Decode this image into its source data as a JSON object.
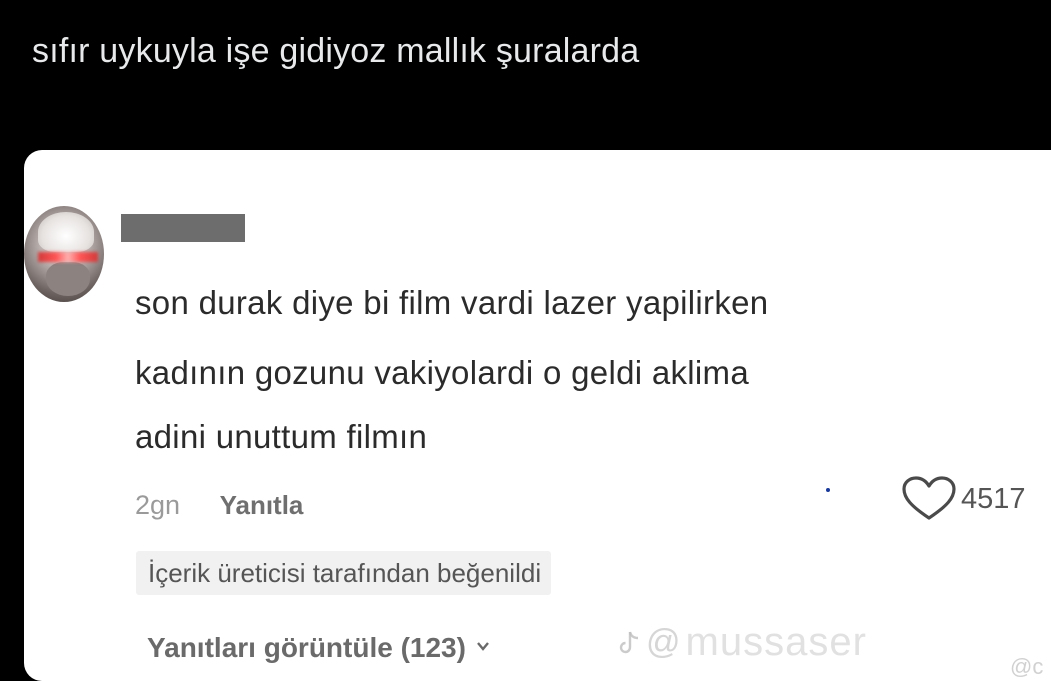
{
  "tweet": {
    "text": "sıfır uykuyla işe gidiyoz mallık şuralarda"
  },
  "comment": {
    "lines": [
      "son durak  diye bi film vardi lazer yapilirken",
      "kadının gozunu vakiyolardi o geldi aklima",
      "adini unuttum filmın"
    ],
    "time": "2gn",
    "reply_label": "Yanıtla",
    "like_count": "4517",
    "creator_badge": "İçerik üreticisi tarafından beğenildi",
    "view_replies": "Yanıtları görüntüle (123)"
  },
  "watermark": {
    "handle": "mussaser",
    "corner": "@c"
  },
  "icons": {
    "like": "heart-icon",
    "expand": "chevron-down-icon",
    "watermark_logo": "tiktok-icon"
  },
  "colors": {
    "background": "#000000",
    "tweet_text": "#e7e9ea",
    "card": "#ffffff",
    "comment_text": "#2b2b2b",
    "meta_text": "#8a8a8a",
    "badge_bg": "#f1f1f1"
  }
}
